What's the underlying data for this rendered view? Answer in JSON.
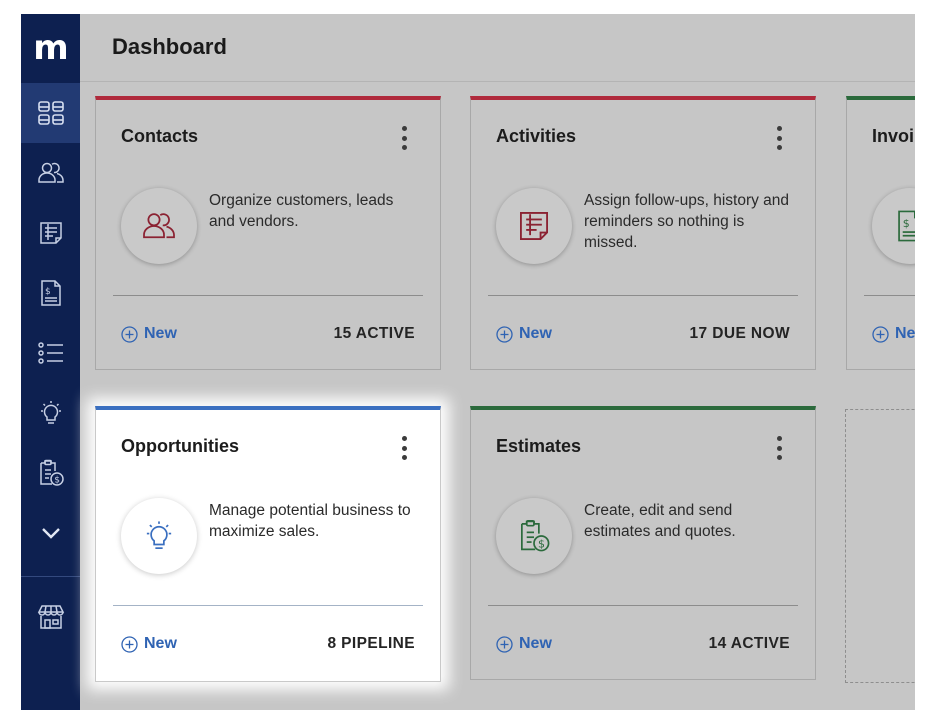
{
  "app": {
    "logo": "m",
    "page_title": "Dashboard"
  },
  "sidebar": {
    "items": [
      {
        "icon": "dashboard-icon",
        "active": true
      },
      {
        "icon": "contacts-icon"
      },
      {
        "icon": "activities-icon"
      },
      {
        "icon": "invoice-icon"
      },
      {
        "icon": "list-icon"
      },
      {
        "icon": "lightbulb-icon"
      },
      {
        "icon": "estimate-icon"
      },
      {
        "icon": "chevron-down-icon"
      },
      {
        "icon": "store-icon"
      }
    ]
  },
  "cards": {
    "contacts": {
      "title": "Contacts",
      "description": "Organize customers, leads and vendors.",
      "new_label": "New",
      "count": "15 ACTIVE"
    },
    "activities": {
      "title": "Activities",
      "description": "Assign follow-ups, history and reminders so nothing is missed.",
      "new_label": "New",
      "count": "17 DUE NOW"
    },
    "invoices": {
      "title": "Invoi",
      "new_label": "Ne"
    },
    "opportunities": {
      "title": "Opportunities",
      "description": "Manage potential business to maximize sales.",
      "new_label": "New",
      "count": "8 PIPELINE"
    },
    "estimates": {
      "title": "Estimates",
      "description": "Create, edit and send estimates and quotes.",
      "new_label": "New",
      "count": "14 ACTIVE"
    }
  },
  "colors": {
    "sidebar": "#0d2050",
    "accent_red": "#b02a3c",
    "accent_green": "#2b6a3c",
    "accent_blue": "#3a6fc0",
    "link": "#2f63b3"
  }
}
